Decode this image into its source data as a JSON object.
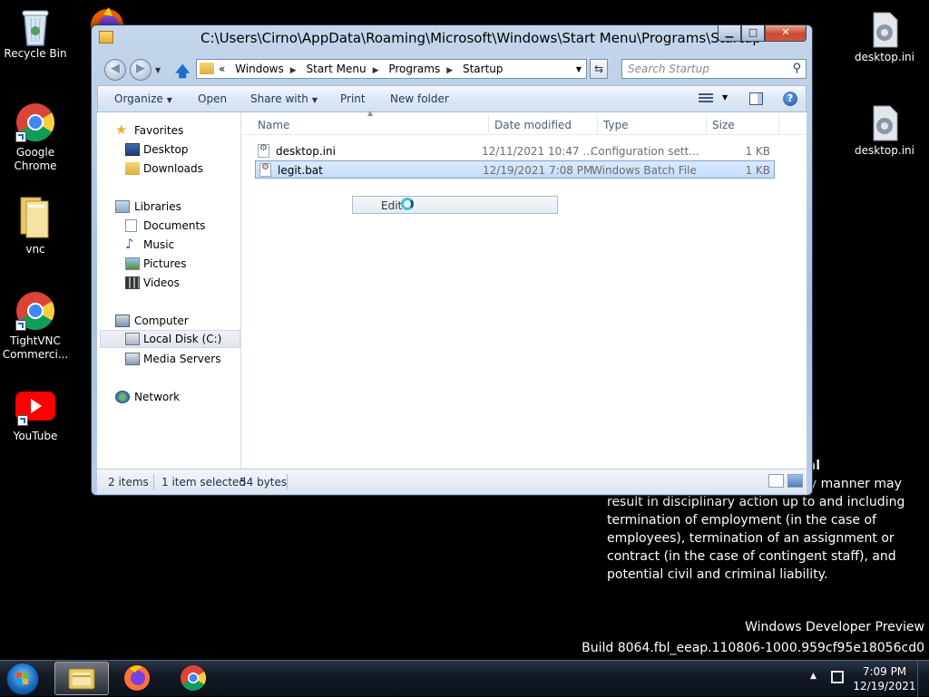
{
  "desktop": {
    "icons_left": [
      {
        "label": "Recycle Bin"
      },
      {
        "label": "Google Chrome"
      },
      {
        "label": "vnc"
      },
      {
        "label": "TightVNC Commerci..."
      },
      {
        "label": "YouTube"
      }
    ],
    "icons_right": [
      {
        "label": "desktop.ini"
      },
      {
        "label": "desktop.ini"
      }
    ],
    "notice": {
      "bold_fragment": "ial",
      "line1_fragment": "ny manner may",
      "lines": [
        "result in disciplinary action up to and including",
        "termination of employment (in the case of",
        "employees), termination of an assignment or",
        "contract (in the case of contingent staff), and",
        "potential civil and criminal liability."
      ]
    },
    "watermark": {
      "line1": "Windows Developer Preview",
      "line2": "Build 8064.fbl_eeap.110806-1000.959cf95e18056cd0"
    }
  },
  "window": {
    "title": "C:\\Users\\Cirno\\AppData\\Roaming\\Microsoft\\Windows\\Start Menu\\Programs\\Startup",
    "address": {
      "overflow": "«",
      "crumbs": [
        "Windows",
        "Start Menu",
        "Programs",
        "Startup"
      ]
    },
    "search_placeholder": "Search Startup",
    "commands": {
      "organize": "Organize",
      "open": "Open",
      "share_with": "Share with",
      "print": "Print",
      "new_folder": "New folder"
    },
    "nav_pane": {
      "favorites": "Favorites",
      "desktop": "Desktop",
      "downloads": "Downloads",
      "libraries": "Libraries",
      "documents": "Documents",
      "music": "Music",
      "pictures": "Pictures",
      "videos": "Videos",
      "computer": "Computer",
      "local_disk": "Local Disk (C:)",
      "media_servers": "Media Servers",
      "network": "Network"
    },
    "columns": {
      "name": "Name",
      "date_modified": "Date modified",
      "type": "Type",
      "size": "Size"
    },
    "files": [
      {
        "name": "desktop.ini",
        "date": "12/11/2021 10:47 ...",
        "type": "Configuration sett...",
        "size": "1 KB"
      },
      {
        "name": "legit.bat",
        "date": "12/19/2021 7:08 PM",
        "type": "Windows Batch File",
        "size": "1 KB"
      }
    ],
    "rename_box": {
      "label": "Edit"
    },
    "status": {
      "items": "2 items",
      "selected": "1 item selected",
      "bytes": "54 bytes"
    }
  },
  "taskbar": {
    "clock_time": "7:09 PM",
    "clock_date": "12/19/2021"
  }
}
